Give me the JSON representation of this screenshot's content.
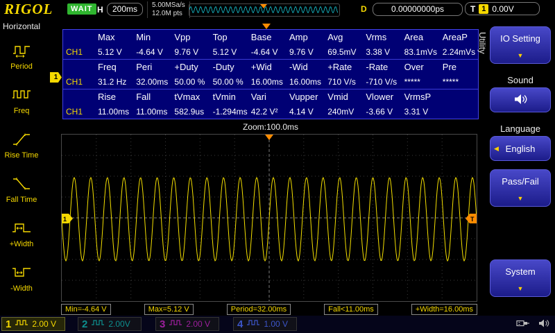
{
  "colors": {
    "accent_yellow": "#f5d800",
    "trigger_orange": "#ff8c00",
    "table_bg": "#000074",
    "menu_blue": "#2a2ab4",
    "ch1": "#f5d800",
    "ch2": "#00b4b4",
    "ch3": "#b400b4",
    "ch4": "#4060e0",
    "preview_cyan": "#18c8d8",
    "status_green": "#2fb52f"
  },
  "icons": {
    "chevron_down": "▼",
    "chevron_left": "◀"
  },
  "markers": {
    "ch1_position": "1",
    "trigger_level": "T"
  },
  "top_bar": {
    "logo": "RIGOL",
    "status": "WAIT",
    "h_label": "H",
    "timebase": "200ms",
    "sample_rate": "5.00MSa/s",
    "memory_depth": "12.0M pts",
    "d_label": "D",
    "delay_value": "0.00000000ps",
    "t_label": "T",
    "trigger_source": "1",
    "trigger_level": "0.00V"
  },
  "left_menu": {
    "title": "Horizontal",
    "items": [
      {
        "label": "Period",
        "icon": "period-icon"
      },
      {
        "label": "Freq",
        "icon": "freq-icon"
      },
      {
        "label": "Rise Time",
        "icon": "rise-time-icon"
      },
      {
        "label": "Fall Time",
        "icon": "fall-time-icon"
      },
      {
        "label": "+Width",
        "icon": "plus-width-icon"
      },
      {
        "label": "-Width",
        "icon": "minus-width-icon"
      }
    ]
  },
  "measurement_table": {
    "groups": [
      {
        "channel": "CH1",
        "headers": [
          "Max",
          "Min",
          "Vpp",
          "Top",
          "Base",
          "Amp",
          "Avg",
          "Vrms",
          "Area",
          "AreaP"
        ],
        "values": [
          "5.12 V",
          "-4.64 V",
          "9.76 V",
          "5.12 V",
          "-4.64 V",
          "9.76 V",
          "69.5mV",
          "3.38 V",
          "83.1mVs",
          "2.24mVs"
        ]
      },
      {
        "channel": "CH1",
        "headers": [
          "Freq",
          "Peri",
          "+Duty",
          "-Duty",
          "+Wid",
          "-Wid",
          "+Rate",
          "-Rate",
          "Over",
          "Pre"
        ],
        "values": [
          "31.2 Hz",
          "32.00ms",
          "50.00 %",
          "50.00 %",
          "16.00ms",
          "16.00ms",
          "710 V/s",
          "-710 V/s",
          "*****",
          "*****"
        ]
      },
      {
        "channel": "CH1",
        "headers": [
          "Rise",
          "Fall",
          "tVmax",
          "tVmin",
          "Vari",
          "Vupper",
          "Vmid",
          "Vlower",
          "VrmsP",
          ""
        ],
        "values": [
          "11.00ms",
          "11.00ms",
          "582.9us",
          "-1.294ms",
          "42.2 V²",
          "4.14 V",
          "240mV",
          "-3.66 V",
          "3.31 V",
          ""
        ]
      }
    ]
  },
  "zoom_label": "Zoom:100.0ms",
  "bottom_measurements": [
    "Min=-4.64 V",
    "Max=5.12 V",
    "Period=32.00ms",
    "Fall<11.00ms",
    "+Width=16.00ms"
  ],
  "channels": [
    {
      "number": "1",
      "scale": "2.00 V",
      "active": true
    },
    {
      "number": "2",
      "scale": "2.00V",
      "active": false
    },
    {
      "number": "3",
      "scale": "2.00 V",
      "active": false
    },
    {
      "number": "4",
      "scale": "1.00 V",
      "active": false
    }
  ],
  "right_menu": {
    "title": "Utility",
    "io_setting": "IO Setting",
    "sound_label": "Sound",
    "language_label": "Language",
    "language_value": "English",
    "pass_fail": "Pass/Fail",
    "system": "System"
  },
  "chart_data": {
    "type": "line",
    "title": "Zoom:100.0ms",
    "waveform": "sine",
    "channel": "CH1",
    "visible_cycles": 25,
    "period_ms": 32.0,
    "frequency_hz": 31.2,
    "vpp_v": 9.76,
    "max_v": 5.12,
    "min_v": -4.64,
    "volts_per_div": 2.0,
    "grid": {
      "h_divisions": 12,
      "v_divisions": 8
    },
    "legend_position": "none",
    "color": "#f5e000"
  }
}
